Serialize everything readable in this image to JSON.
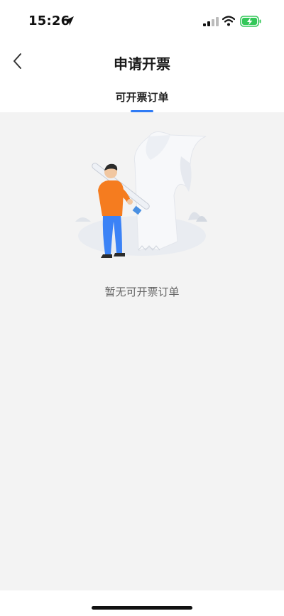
{
  "status_bar": {
    "time": "15:26",
    "icons": [
      "location-arrow-icon",
      "cellular-signal-icon",
      "wifi-icon",
      "battery-charging-icon"
    ]
  },
  "nav": {
    "title": "申请开票",
    "back_icon": "chevron-left-icon"
  },
  "tabs": [
    {
      "label": "可开票订单",
      "active": true
    }
  ],
  "empty_state": {
    "message": "暂无可开票订单",
    "illustration": "person-with-pen-and-receipt-scroll"
  },
  "colors": {
    "accent": "#2f7bf5",
    "background": "#f3f3f3",
    "battery": "#34c759"
  }
}
